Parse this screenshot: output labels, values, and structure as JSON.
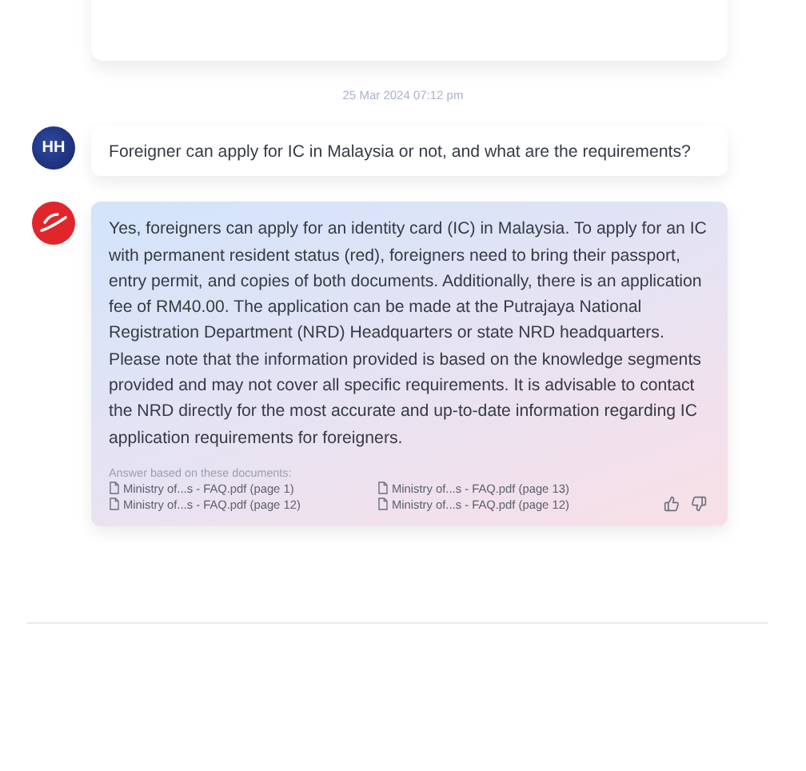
{
  "timestamp": "25 Mar 2024 07:12 pm",
  "messages": [
    {
      "kind": "user",
      "avatar": "HH",
      "text": "Foreigner can apply for IC in Malaysia or not, and what are the requirements?"
    },
    {
      "kind": "bot",
      "text": "Yes, foreigners can apply for an identity card (IC) in Malaysia. To apply for an IC with permanent resident status (red), foreigners need to bring their passport, entry permit, and copies of both documents. Additionally, there is an application fee of RM40.00. The application can be made at the Putrajaya National Registration Department (NRD) Headquarters or state NRD headquarters. Please note that the information provided is based on the knowledge segments provided and may not cover all specific requirements. It is advisable to contact the NRD directly for the most accurate and up-to-date information regarding IC application requirements for foreigners.",
      "sources_label": "Answer based on these documents:",
      "sources": [
        "Ministry of...s - FAQ.pdf (page 1)",
        "Ministry of...s - FAQ.pdf (page 13)",
        "Ministry of...s - FAQ.pdf (page 12)",
        "Ministry of...s - FAQ.pdf (page 12)"
      ]
    }
  ]
}
